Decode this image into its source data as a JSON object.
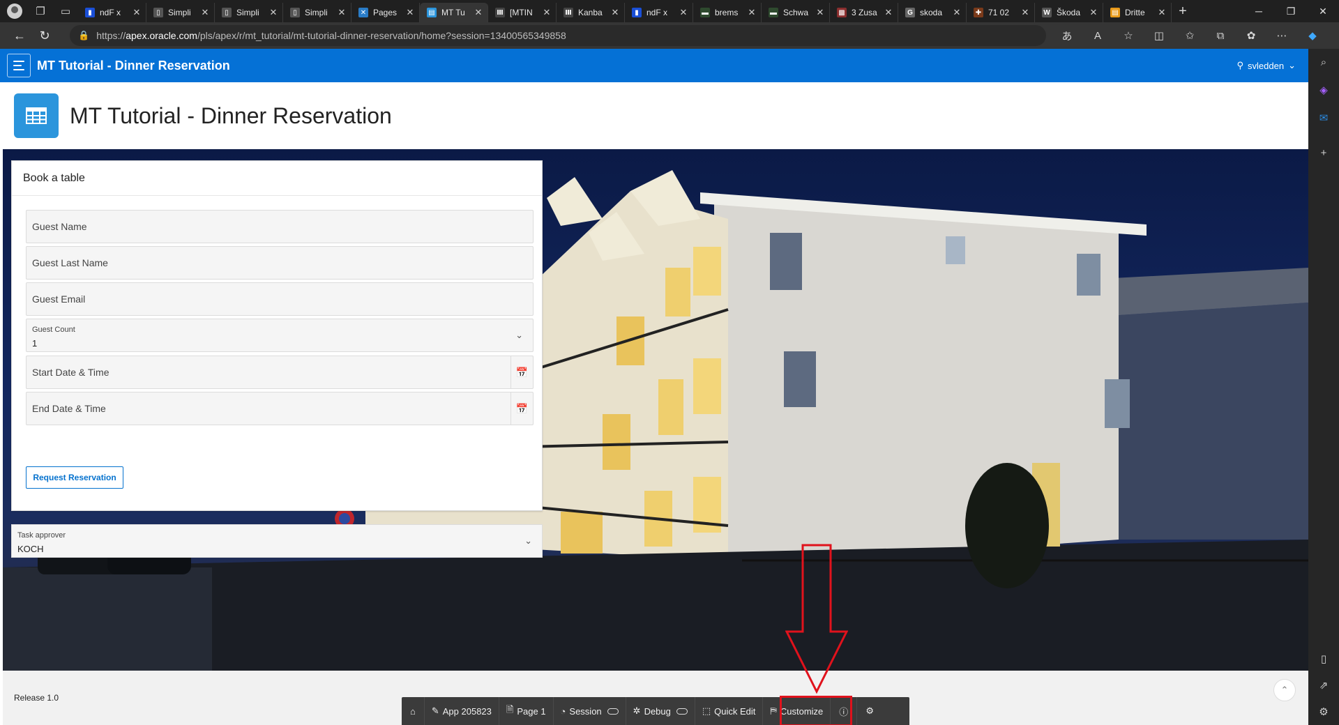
{
  "browser": {
    "tabs": [
      {
        "title": "ndF x",
        "fav_color": "#1a4fd6",
        "fav_glyph": "▮"
      },
      {
        "title": "Simpli",
        "fav_color": "#555555",
        "fav_glyph": "▯"
      },
      {
        "title": "Simpli",
        "fav_color": "#555555",
        "fav_glyph": "▯"
      },
      {
        "title": "Simpli",
        "fav_color": "#555555",
        "fav_glyph": "▯"
      },
      {
        "title": "Pages",
        "fav_color": "#2a7cc7",
        "fav_glyph": "✕"
      },
      {
        "title": "MT Tu",
        "fav_color": "#2b95dc",
        "fav_glyph": "▤",
        "active": true
      },
      {
        "title": "[MTIN",
        "fav_color": "#444444",
        "fav_glyph": "Ⅲ"
      },
      {
        "title": "Kanba",
        "fav_color": "#444444",
        "fav_glyph": "Ⅲ"
      },
      {
        "title": "ndF x",
        "fav_color": "#1a4fd6",
        "fav_glyph": "▮"
      },
      {
        "title": "brems",
        "fav_color": "#2e4a2e",
        "fav_glyph": "▬"
      },
      {
        "title": "Schwa",
        "fav_color": "#2e4a2e",
        "fav_glyph": "▬"
      },
      {
        "title": "3 Zusa",
        "fav_color": "#8a2e2e",
        "fav_glyph": "▩"
      },
      {
        "title": "skoda",
        "fav_color": "#666666",
        "fav_glyph": "G"
      },
      {
        "title": "71 02",
        "fav_color": "#7a3a1a",
        "fav_glyph": "✚"
      },
      {
        "title": "Škoda",
        "fav_color": "#555555",
        "fav_glyph": "W"
      },
      {
        "title": "Dritte",
        "fav_color": "#e89a1a",
        "fav_glyph": "▤"
      }
    ],
    "url_host": "apex.oracle.com",
    "url_path": "/pls/apex/r/mt_tutorial/mt-tutorial-dinner-reservation/home?session=13400565349858",
    "url_scheme": "https://"
  },
  "header": {
    "app_title": "MT Tutorial - Dinner Reservation",
    "username": "svledden"
  },
  "hero": {
    "title": "MT Tutorial - Dinner Reservation"
  },
  "form": {
    "region_title": "Book a table",
    "guest_name": "Guest Name",
    "guest_last_name": "Guest Last Name",
    "guest_email": "Guest Email",
    "guest_count_label": "Guest Count",
    "guest_count_value": "1",
    "start_date": "Start Date & Time",
    "end_date": "End Date & Time",
    "submit_label": "Request Reservation"
  },
  "approver": {
    "label": "Task approver",
    "value": "KOCH"
  },
  "footer": {
    "release": "Release 1.0"
  },
  "devbar": {
    "app": "App 205823",
    "page": "Page 1",
    "session": "Session",
    "debug": "Debug",
    "quick_edit": "Quick Edit",
    "customize": "Customize"
  },
  "colors": {
    "apex_blue": "#0571d6",
    "highlight_red": "#e0121c"
  }
}
